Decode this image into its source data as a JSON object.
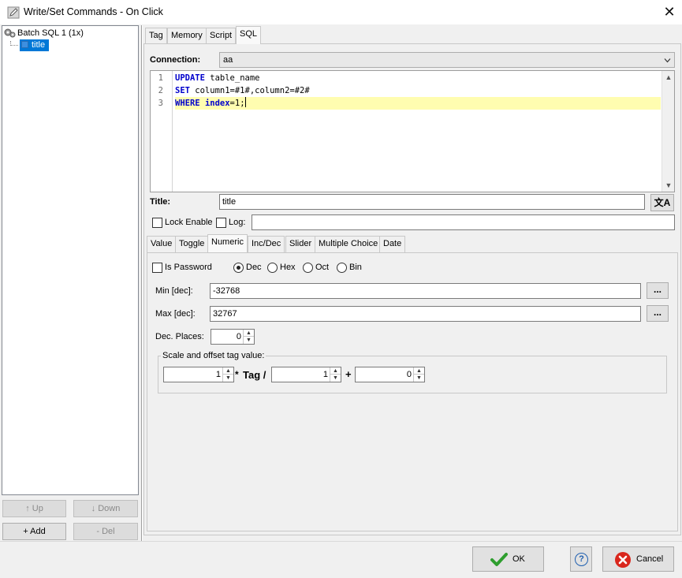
{
  "window": {
    "title": "Write/Set Commands - On Click",
    "close_glyph": "✕"
  },
  "tree": {
    "root_label": "Batch SQL 1 (1x)",
    "child_label": "title"
  },
  "left_buttons": {
    "up": "↑ Up",
    "down": "↓ Down",
    "add": "+ Add",
    "del": "- Del"
  },
  "top_tabs": [
    "Tag",
    "Memory",
    "Script",
    "SQL"
  ],
  "sql": {
    "connection_label": "Connection:",
    "connection_value": "aa",
    "line_numbers": [
      "1",
      "2",
      "3"
    ],
    "code": [
      {
        "kw": "UPDATE",
        "rest": " table_name"
      },
      {
        "kw": "SET",
        "rest": " column1=#1#,column2=#2#"
      },
      {
        "kw": "WHERE",
        "kw2": "index",
        "rest": "=1;"
      }
    ]
  },
  "title_row": {
    "label": "Title:",
    "value": "title",
    "translate_glyph": "文A"
  },
  "options": {
    "lock_enable": "Lock Enable",
    "log": "Log:",
    "log_value": ""
  },
  "sub_tabs": [
    "Value",
    "Toggle",
    "Numeric",
    "Inc/Dec",
    "Slider",
    "Multiple Choice",
    "Date"
  ],
  "numeric": {
    "is_password": "Is Password",
    "radios": [
      "Dec",
      "Hex",
      "Oct",
      "Bin"
    ],
    "selected_radio": "Dec",
    "min_label": "Min [dec]:",
    "min_value": "-32768",
    "max_label": "Max [dec]:",
    "max_value": "32767",
    "ellipsis": "...",
    "dec_places_label": "Dec. Places:",
    "dec_places_value": "0",
    "scale_group_label": "Scale and offset tag value:",
    "scale_value": "1",
    "star": "*",
    "tag_word": "Tag /",
    "divisor_value": "1",
    "plus": "+",
    "offset_value": "0"
  },
  "footer": {
    "ok": "OK",
    "help": "?",
    "cancel": "Cancel"
  },
  "colors": {
    "selection": "#0078d7",
    "keyword": "#0000cc",
    "active_line": "#fffdb0",
    "ok_check": "#2e9e2e",
    "cancel_red": "#d9261c"
  }
}
